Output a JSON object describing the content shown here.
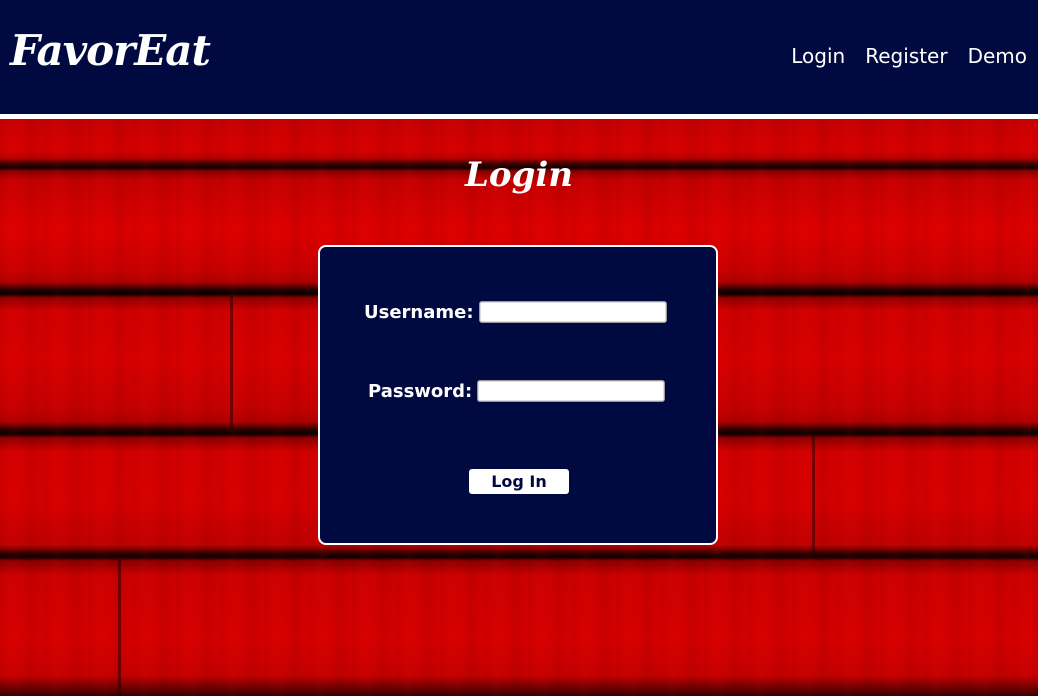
{
  "header": {
    "brand": "FavorEat",
    "nav": [
      {
        "label": "Login"
      },
      {
        "label": "Register"
      },
      {
        "label": "Demo"
      }
    ]
  },
  "main": {
    "title": "Login",
    "form": {
      "username_label": "Username:",
      "username_value": "",
      "password_label": "Password:",
      "password_value": "",
      "submit_label": "Log In"
    }
  },
  "colors": {
    "navy": "#000a40",
    "wood_red": "#c40000",
    "white": "#ffffff"
  }
}
